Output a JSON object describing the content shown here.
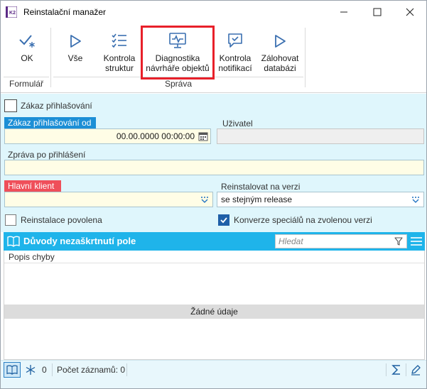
{
  "window": {
    "title": "Reinstalační manažer",
    "app_icon": "K2"
  },
  "ribbon": {
    "groups": [
      {
        "label": "Formulář",
        "buttons": [
          {
            "label": "OK",
            "icon": "check-star-icon"
          }
        ]
      },
      {
        "label": "Správa",
        "buttons": [
          {
            "label": "Vše",
            "icon": "play-icon"
          },
          {
            "label": "Kontrola struktur",
            "icon": "checklist-icon"
          },
          {
            "label": "Diagnostika návrháře objektů",
            "icon": "monitor-pulse-icon"
          },
          {
            "label": "Kontrola notifikací",
            "icon": "chat-check-icon"
          },
          {
            "label": "Zálohovat databázi",
            "icon": "play-icon"
          }
        ]
      }
    ]
  },
  "form": {
    "login_ban_checkbox": {
      "label": "Zákaz přihlašování",
      "checked": false
    },
    "login_ban_from": {
      "label": "Zákaz přihlašování od",
      "value": "00.00.0000 00:00:00"
    },
    "user": {
      "label": "Uživatel",
      "value": ""
    },
    "message_after_login": {
      "label": "Zpráva po přihlášení",
      "value": ""
    },
    "main_client": {
      "label": "Hlavní klient",
      "value": ""
    },
    "reinstall_version": {
      "label": "Reinstalovat na verzi",
      "value": "se stejným release"
    },
    "reinstall_allowed": {
      "label": "Reinstalace povolena",
      "checked": false
    },
    "convert_specials": {
      "label": "Konverze speciálů na zvolenou verzi",
      "checked": true
    }
  },
  "grid": {
    "title": "Důvody nezaškrtnutí pole",
    "search_placeholder": "Hledat",
    "columns": [
      "Popis chyby"
    ],
    "empty_text": "Žádné údaje"
  },
  "status": {
    "filter_count": "0",
    "records_label": "Počet záznamů: 0"
  },
  "colors": {
    "accent": "#1fb4ea",
    "label_blue": "#1c8fd6",
    "label_red": "#ef4f5a",
    "highlight": "#e8202a",
    "form_bg": "#dff6fc"
  }
}
